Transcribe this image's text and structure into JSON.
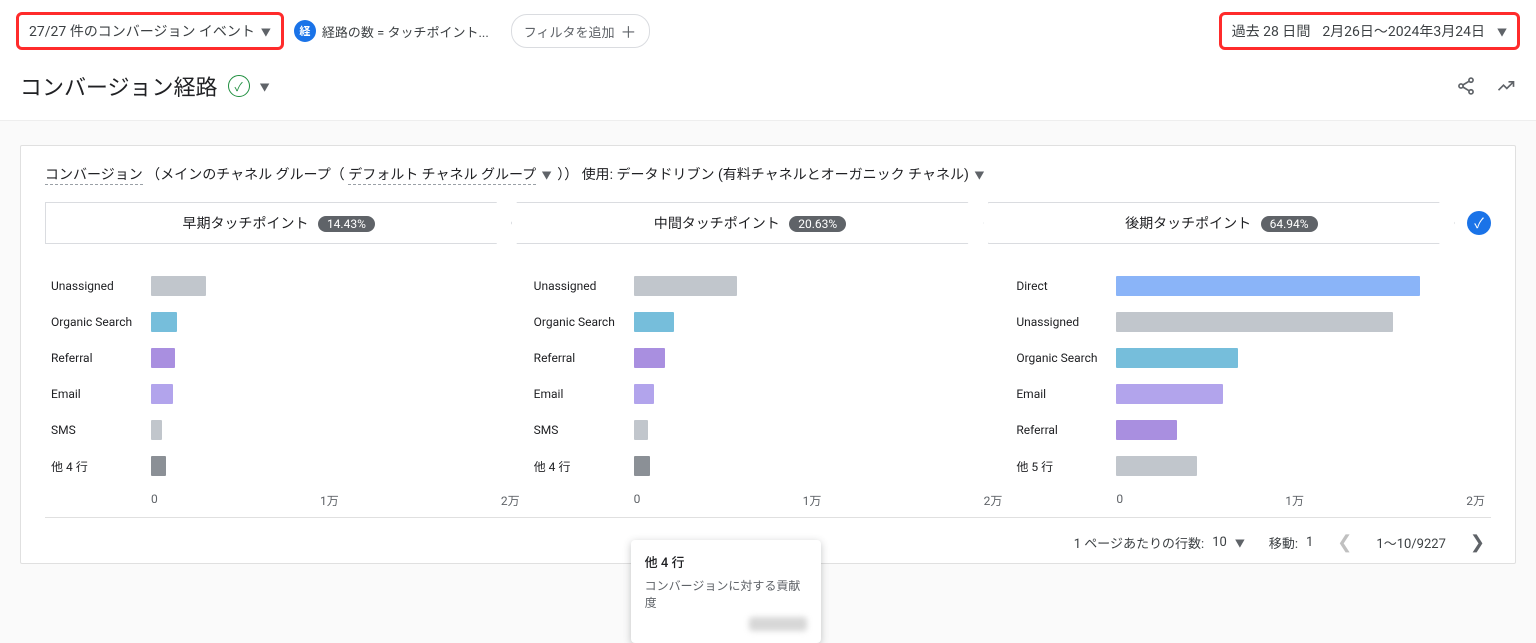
{
  "topbar": {
    "conv_events": "27/27 件のコンバージョン イベント",
    "pathlen_badge": "経",
    "pathlen_text": "経路の数 = タッチポイント...",
    "add_filter": "フィルタを追加",
    "date_preset": "過去 28 日間",
    "date_range": "2月26日～2024年3月24日"
  },
  "title": {
    "heading": "コンバージョン経路"
  },
  "card": {
    "dim_label": "コンバージョン",
    "group_prefix": "（メインのチャネル グループ（",
    "group_value": "デフォルト チャネル グループ",
    "group_suffix": "））",
    "attr_label": "使用: データドリブン (有料チャネルとオーガニック チャネル)"
  },
  "stages": [
    {
      "label": "早期タッチポイント",
      "pct": "14.43%"
    },
    {
      "label": "中間タッチポイント",
      "pct": "20.63%"
    },
    {
      "label": "後期タッチポイント",
      "pct": "64.94%"
    }
  ],
  "chart_data": [
    {
      "type": "bar",
      "xlabel": "",
      "ylabel": "",
      "xlim": [
        0,
        20000
      ],
      "ticks": [
        "0",
        "1万",
        "2万"
      ],
      "series": [
        {
          "name": "Unassigned",
          "color": "c-grey",
          "value": 3000
        },
        {
          "name": "Organic Search",
          "color": "c-teal",
          "value": 1400
        },
        {
          "name": "Referral",
          "color": "c-purple",
          "value": 1300
        },
        {
          "name": "Email",
          "color": "c-lavender",
          "value": 1200
        },
        {
          "name": "SMS",
          "color": "c-grey",
          "value": 600
        },
        {
          "name": "他 4 行",
          "color": "c-greydark",
          "value": 800
        }
      ]
    },
    {
      "type": "bar",
      "xlabel": "",
      "ylabel": "",
      "xlim": [
        0,
        20000
      ],
      "ticks": [
        "0",
        "1万",
        "2万"
      ],
      "series": [
        {
          "name": "Unassigned",
          "color": "c-grey",
          "value": 5600
        },
        {
          "name": "Organic Search",
          "color": "c-teal",
          "value": 2200
        },
        {
          "name": "Referral",
          "color": "c-purple",
          "value": 1700
        },
        {
          "name": "Email",
          "color": "c-lavender",
          "value": 1100
        },
        {
          "name": "SMS",
          "color": "c-grey",
          "value": 800
        },
        {
          "name": "他 4 行",
          "color": "c-greydark",
          "value": 900
        }
      ]
    },
    {
      "type": "bar",
      "xlabel": "",
      "ylabel": "",
      "xlim": [
        0,
        20000
      ],
      "ticks": [
        "0",
        "1万",
        "2万"
      ],
      "series": [
        {
          "name": "Direct",
          "color": "c-blue",
          "value": 16500
        },
        {
          "name": "Unassigned",
          "color": "c-grey",
          "value": 15000
        },
        {
          "name": "Organic Search",
          "color": "c-teal",
          "value": 6600
        },
        {
          "name": "Email",
          "color": "c-lavender",
          "value": 5800
        },
        {
          "name": "Referral",
          "color": "c-purple",
          "value": 3300
        },
        {
          "name": "他 5 行",
          "color": "c-grey",
          "value": 4400
        }
      ]
    }
  ],
  "tooltip": {
    "title": "他 4 行",
    "subtitle": "コンバージョンに対する貢献度"
  },
  "pager": {
    "rows_label": "1 ページあたりの行数:",
    "rows_value": "10",
    "goto_label": "移動:",
    "goto_value": "1",
    "range": "1～10/9227"
  }
}
